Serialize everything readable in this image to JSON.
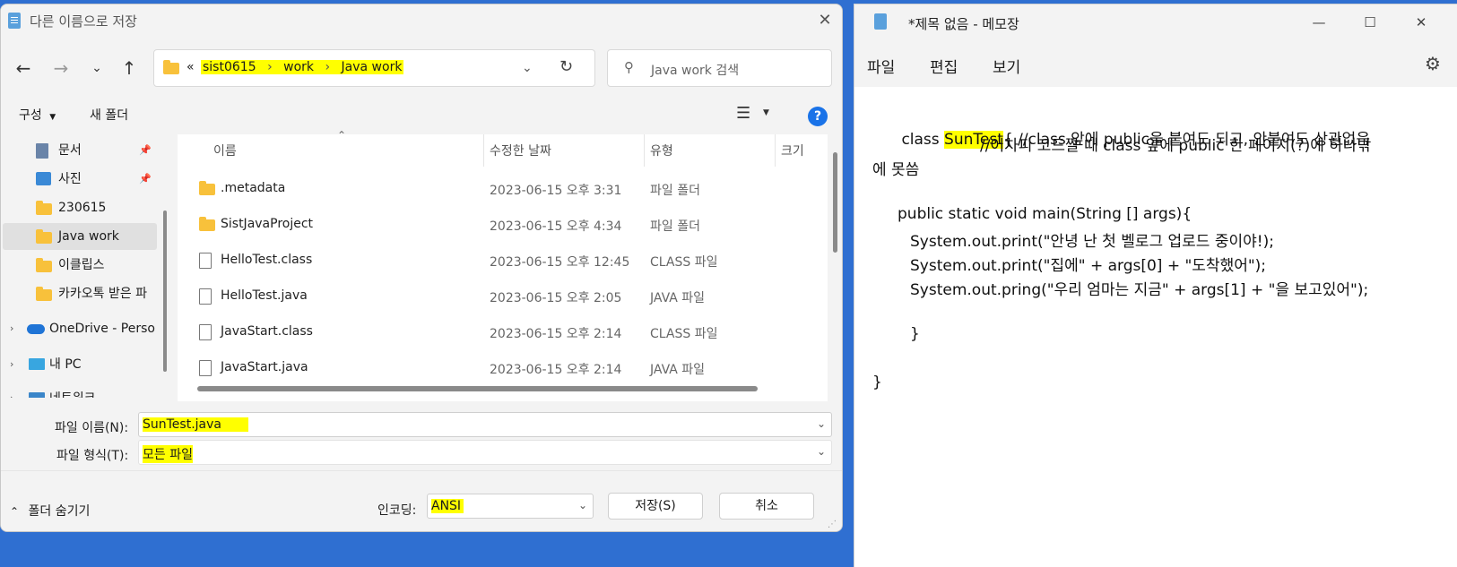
{
  "save_dialog": {
    "title": "다른 이름으로 저장",
    "address": {
      "prefix": "«",
      "crumbs": [
        "sist0615",
        "work",
        "Java work"
      ],
      "separator": "›"
    },
    "search_placeholder": "Java work 검색",
    "toolbar": {
      "organize": "구성",
      "new_folder": "새 폴더"
    },
    "nav_items": [
      {
        "label": "문서",
        "icon": "document-icon",
        "pinned": true
      },
      {
        "label": "사진",
        "icon": "picture-icon",
        "pinned": true
      },
      {
        "label": "230615",
        "icon": "folder-icon"
      },
      {
        "label": "Java work",
        "icon": "folder-icon",
        "selected": true
      },
      {
        "label": "이클립스",
        "icon": "folder-icon"
      },
      {
        "label": "카카오톡 받은 파",
        "icon": "folder-icon"
      },
      {
        "label": "OneDrive - Perso",
        "icon": "cloud-icon",
        "expandable": true
      },
      {
        "label": "내 PC",
        "icon": "pc-icon",
        "expandable": true
      },
      {
        "label": "네트워크",
        "icon": "network-icon",
        "expandable": true
      }
    ],
    "columns": {
      "name": "이름",
      "modified": "수정한 날짜",
      "type": "유형",
      "size": "크기"
    },
    "files": [
      {
        "name": ".metadata",
        "date": "2023-06-15 오후 3:31",
        "type": "파일 폴더",
        "kind": "folder"
      },
      {
        "name": "SistJavaProject",
        "date": "2023-06-15 오후 4:34",
        "type": "파일 폴더",
        "kind": "folder"
      },
      {
        "name": "HelloTest.class",
        "date": "2023-06-15 오후 12:45",
        "type": "CLASS 파일",
        "kind": "file"
      },
      {
        "name": "HelloTest.java",
        "date": "2023-06-15 오후 2:05",
        "type": "JAVA 파일",
        "kind": "file"
      },
      {
        "name": "JavaStart.class",
        "date": "2023-06-15 오후 2:14",
        "type": "CLASS 파일",
        "kind": "file"
      },
      {
        "name": "JavaStart.java",
        "date": "2023-06-15 오후 2:14",
        "type": "JAVA 파일",
        "kind": "file"
      }
    ],
    "filename_label": "파일 이름(N):",
    "filename_value": "SunTest.java",
    "filetype_label": "파일 형식(T):",
    "filetype_value": "모든 파일",
    "hide_folders": "폴더 숨기기",
    "encoding_label": "인코딩:",
    "encoding_value": "ANSI",
    "save_button": "저장(S)",
    "cancel_button": "취소"
  },
  "notepad": {
    "title": "*제목 없음 - 메모장",
    "menu": [
      "파일",
      "편집",
      "보기"
    ],
    "lines": {
      "l1_pre": "class ",
      "l1_hl": "SunTest",
      "l1_post": "{ //class 앞에 public을 붙여도 되고, 안붙여도 상관없음",
      "l2": "//어차피 코드짤 때 class 앞에 public 한 페이지(?)에 하나밖",
      "l3": "에 못씀",
      "l4": "public static void main(String [] args){",
      "l5": "System.out.print(\"안녕 난 첫 벨로그 업로드 중이야!);",
      "l6": "System.out.print(\"집에\" + args[0] + \"도착했어\");",
      "l7": "System.out.pring(\"우리 엄마는 지금\" + args[1] + \"을 보고있어\");",
      "l8": "}",
      "l9": "}"
    }
  }
}
